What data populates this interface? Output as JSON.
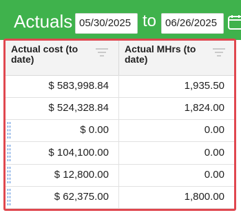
{
  "header": {
    "title": "Actuals",
    "date_from": "05/30/2025",
    "to_label": "to",
    "date_to": "06/26/2025"
  },
  "table": {
    "columns": [
      {
        "label": "Actual cost (to date)"
      },
      {
        "label": "Actual MHrs (to date)"
      }
    ],
    "rows": [
      {
        "cost": "$ 583,998.84",
        "mhrs": "1,935.50",
        "handle": false
      },
      {
        "cost": "$ 524,328.84",
        "mhrs": "1,824.00",
        "handle": false
      },
      {
        "cost": "$ 0.00",
        "mhrs": "0.00",
        "handle": true
      },
      {
        "cost": "$ 104,100.00",
        "mhrs": "0.00",
        "handle": true
      },
      {
        "cost": "$ 12,800.00",
        "mhrs": "0.00",
        "handle": true
      },
      {
        "cost": "$ 62,375.00",
        "mhrs": "1,800.00",
        "handle": true
      }
    ]
  },
  "colors": {
    "header_bg": "#3fb24c",
    "highlight_border": "#e0474f"
  },
  "icons": [
    "calendar-icon",
    "filter-icon"
  ]
}
